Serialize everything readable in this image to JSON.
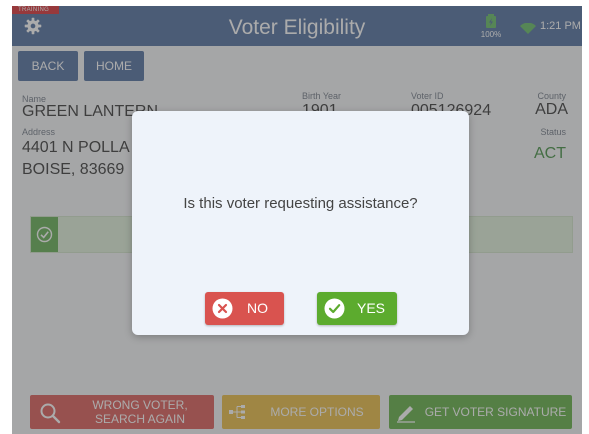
{
  "header": {
    "training_badge": "TRAINING",
    "title": "Voter Eligibility",
    "battery_percent": "100%",
    "time": "1:21 PM"
  },
  "nav": {
    "back_label": "BACK",
    "home_label": "HOME"
  },
  "voter": {
    "name_label": "Name",
    "name": "GREEN LANTERN",
    "address_label": "Address",
    "address_line1": "4401 N POLLA",
    "address_line2": "BOISE, 83669",
    "birth_year_label": "Birth Year",
    "birth_year": "1901",
    "voter_id_label": "Voter ID",
    "voter_id": "005126924",
    "county_label": "County",
    "county": "ADA",
    "status_label": "Status",
    "status": "ACT"
  },
  "actions": {
    "wrong_voter_line1": "WRONG VOTER,",
    "wrong_voter_line2": "SEARCH AGAIN",
    "more_options": "MORE OPTIONS",
    "get_signature": "GET VOTER SIGNATURE"
  },
  "modal": {
    "question": "Is this voter requesting assistance?",
    "no_label": "NO",
    "yes_label": "YES"
  },
  "colors": {
    "header_bg": "#48689a",
    "training_red": "#d9252b",
    "status_green": "#3a8a3a",
    "no_red": "#d9534f",
    "yes_green": "#5cab2e",
    "wrong_voter_red": "#d9534f",
    "more_options_yellow": "#e8b93a",
    "signature_green": "#5aab3c"
  }
}
